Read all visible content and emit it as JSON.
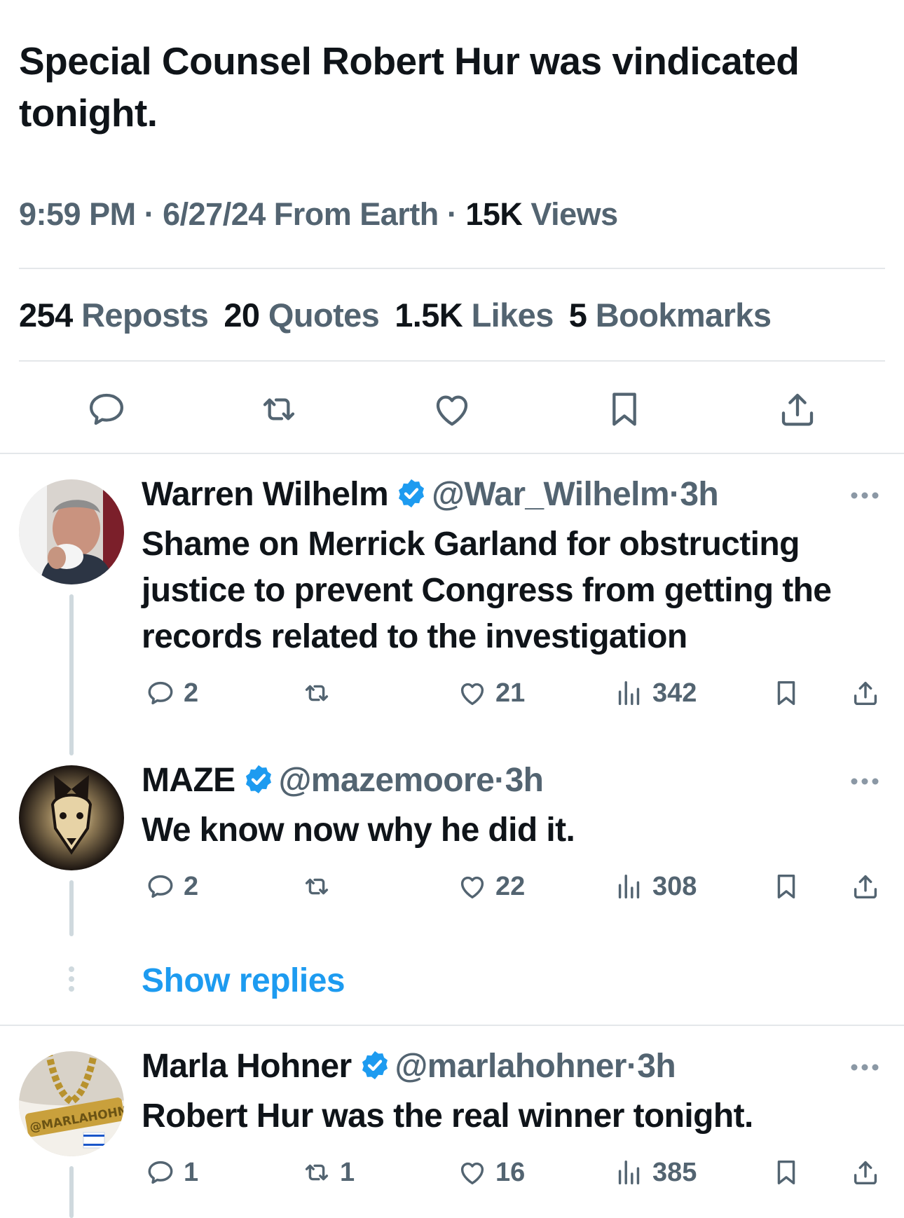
{
  "main_tweet": {
    "text": "Special Counsel Robert Hur was vindicated tonight.",
    "time": "9:59 PM",
    "date": "6/27/24",
    "source": "From Earth",
    "views_count": "15K",
    "views_label": "Views",
    "stats": {
      "reposts_count": "254",
      "reposts_label": "Reposts",
      "quotes_count": "20",
      "quotes_label": "Quotes",
      "likes_count": "1.5K",
      "likes_label": "Likes",
      "bookmarks_count": "5",
      "bookmarks_label": "Bookmarks"
    },
    "actions": [
      "reply-icon",
      "repost-icon",
      "like-icon",
      "bookmark-icon",
      "share-icon"
    ]
  },
  "replies": [
    {
      "name": "Warren Wilhelm",
      "handle": "@War_Wilhelm",
      "time": "3h",
      "text": "Shame on Merrick Garland for obstructing justice to prevent Congress from getting the records related to the investigation",
      "reply_count": "2",
      "repost_count": "",
      "like_count": "21",
      "view_count": "342"
    },
    {
      "name": "MAZE",
      "handle": "@mazemoore",
      "time": "3h",
      "text": "We know now why he did it.",
      "reply_count": "2",
      "repost_count": "",
      "like_count": "22",
      "view_count": "308"
    },
    {
      "name": "Marla Hohner",
      "handle": "@marlahohner",
      "time": "3h",
      "text": "Robert Hur was the real winner tonight.",
      "reply_count": "1",
      "repost_count": "1",
      "like_count": "16",
      "view_count": "385",
      "avatar_text": "@MARLAHOHNER"
    }
  ],
  "show_replies_label": "Show replies",
  "separator": "·",
  "colors": {
    "text": "#0f1419",
    "secondary": "#536471",
    "accent": "#1d9bf0",
    "divider": "#e4e7ea",
    "thread_line": "#cfd9de"
  }
}
